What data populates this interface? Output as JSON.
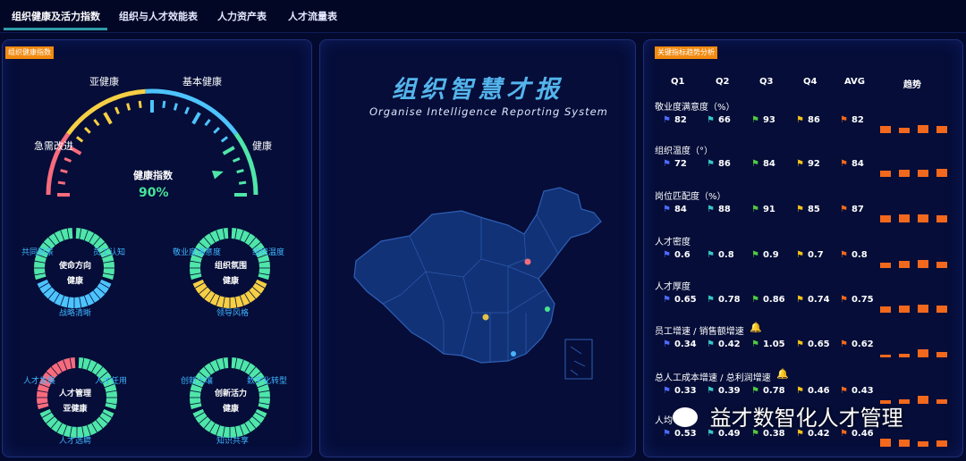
{
  "tabs": [
    {
      "label": "组织健康及活力指数",
      "active": true
    },
    {
      "label": "组织与人才效能表",
      "active": false
    },
    {
      "label": "人力资产表",
      "active": false
    },
    {
      "label": "人才流量表",
      "active": false
    }
  ],
  "left_panel": {
    "badge": "组织健康指数",
    "gauge": {
      "labels": {
        "critical": "急需改进",
        "sub": "亚健康",
        "basic": "基本健康",
        "healthy": "健康"
      },
      "title": "健康指数",
      "value_text": "90%",
      "value": 0.9
    },
    "rings": [
      {
        "center": [
          "使命方向",
          "健康"
        ],
        "labels": [
          "共同愿景",
          "员工认知",
          "战略清晰"
        ]
      },
      {
        "center": [
          "组织氛围",
          "健康"
        ],
        "labels": [
          "敬业度满意度",
          "组织温度",
          "领导风格"
        ]
      },
      {
        "center": [
          "人才管理",
          "亚健康"
        ],
        "labels": [
          "人才发展",
          "人才任用",
          "人才选聘"
        ]
      },
      {
        "center": [
          "创新活力",
          "健康"
        ],
        "labels": [
          "创新土壤",
          "数字化转型",
          "知识共享"
        ]
      }
    ]
  },
  "center_panel": {
    "title_cn": "组织智慧才报",
    "title_en": "Organise Intelligence Reporting System"
  },
  "right_panel": {
    "badge": "关键指标趋势分析",
    "headers": [
      "Q1",
      "Q2",
      "Q3",
      "Q4",
      "AVG",
      "趋势"
    ],
    "metrics": [
      {
        "label": "敬业度满意度（%）",
        "values": [
          "82",
          "66",
          "93",
          "86",
          "82"
        ],
        "bell": false
      },
      {
        "label": "组织温度（°）",
        "values": [
          "72",
          "86",
          "84",
          "92",
          "84"
        ],
        "bell": false
      },
      {
        "label": "岗位匹配度（%）",
        "values": [
          "84",
          "88",
          "91",
          "85",
          "87"
        ],
        "bell": false
      },
      {
        "label": "人才密度",
        "values": [
          "0.6",
          "0.8",
          "0.9",
          "0.7",
          "0.8"
        ],
        "bell": false
      },
      {
        "label": "人才厚度",
        "values": [
          "0.65",
          "0.78",
          "0.86",
          "0.74",
          "0.75"
        ],
        "bell": false
      },
      {
        "label": "员工增速 / 销售额增速",
        "values": [
          "0.34",
          "0.42",
          "1.05",
          "0.65",
          "0.62"
        ],
        "bell": true
      },
      {
        "label": "总人工成本增速 / 总利润增速",
        "values": [
          "0.33",
          "0.39",
          "0.78",
          "0.46",
          "0.43"
        ],
        "bell": true
      },
      {
        "label": "人均",
        "values": [
          "0.53",
          "0.49",
          "0.38",
          "0.42",
          "0.46"
        ],
        "bell": false
      }
    ],
    "flag_colors": [
      "#4d6bff",
      "#37c6c4",
      "#4ecb3f",
      "#f2c21b",
      "#f2681d"
    ]
  },
  "watermark": "益才数智化人才管理"
}
